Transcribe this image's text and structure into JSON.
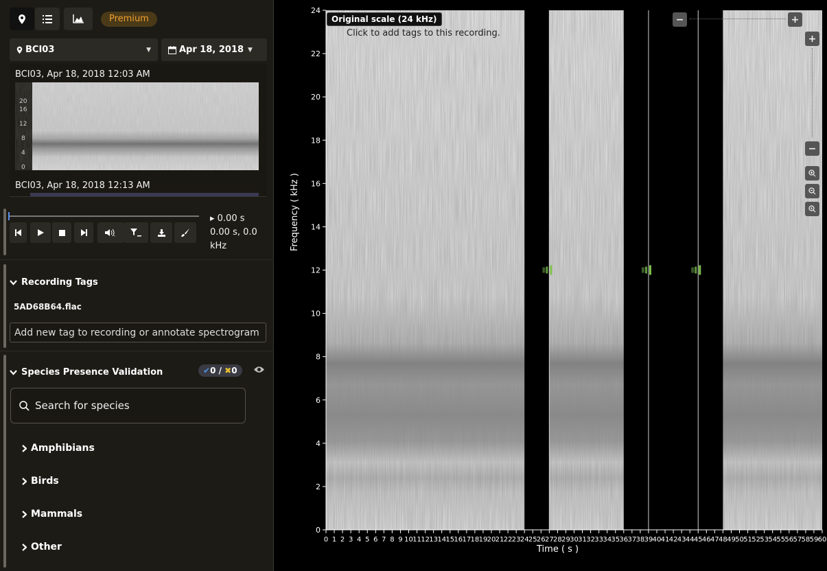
{
  "toolbar": {
    "tabs": [
      {
        "icon": "map-pin-icon"
      },
      {
        "icon": "list-icon"
      },
      {
        "icon": "area-chart-icon"
      }
    ],
    "premium_label": "Premium"
  },
  "site_select": {
    "value": "BCI03",
    "icon": "map-pin-icon"
  },
  "date_select": {
    "value": "Apr 18, 2018",
    "icon": "calendar-icon"
  },
  "recordings": [
    {
      "title": "BCI03, Apr 18, 2018 12:03 AM",
      "thumb_ticks": [
        "20",
        "16",
        "12",
        "8",
        "4",
        "0"
      ]
    },
    {
      "title": "BCI03, Apr 18, 2018 12:13 AM"
    }
  ],
  "player": {
    "time": "▸ 0.00 s",
    "cursor_line1": "0.00 s, 0.0",
    "cursor_line2": "kHz",
    "buttons": [
      "skip-back-icon",
      "play-icon",
      "stop-icon",
      "skip-forward-icon",
      "volume-icon",
      "filter-icon",
      "download-icon",
      "brush-icon"
    ],
    "position": 0
  },
  "recording_tags": {
    "heading": "Recording Tags",
    "filename": "5AD68B64.flac",
    "input_placeholder": "Add new tag to recording or annotate spectrogram"
  },
  "validation": {
    "heading": "Species Presence Validation",
    "present_count": "0",
    "separator": " / ",
    "absent_count": "0",
    "search_placeholder": "Search for species",
    "categories": [
      "Amphibians",
      "Birds",
      "Mammals",
      "Other"
    ]
  },
  "spectrogram": {
    "scale_label": "Original scale (24 kHz)",
    "hint": "Click to add tags to this recording.",
    "ylabel": "Frequency ( kHz )",
    "xlabel": "Time ( s )",
    "y_range": [
      0,
      24
    ],
    "y_ticks": [
      0,
      2,
      4,
      6,
      8,
      10,
      12,
      14,
      16,
      18,
      20,
      22,
      24
    ],
    "x_range": [
      0,
      60
    ],
    "x_tick_step": 1,
    "gaps_seconds": [
      [
        24,
        27
      ],
      [
        36,
        39
      ],
      [
        39,
        45
      ],
      [
        45,
        48
      ]
    ],
    "selection_lines_seconds": [
      27,
      39,
      45
    ],
    "markers": [
      {
        "time": 27,
        "freq": 12
      },
      {
        "time": 39,
        "freq": 12
      },
      {
        "time": 45,
        "freq": 12
      }
    ],
    "colors": {
      "background": "#000000",
      "axis": "#ffffff",
      "marker": "#7fc24a"
    },
    "zoom_controls": [
      "plus-icon",
      "minus-icon",
      "zoom-in-icon",
      "zoom-out-icon",
      "zoom-reset-icon"
    ]
  }
}
